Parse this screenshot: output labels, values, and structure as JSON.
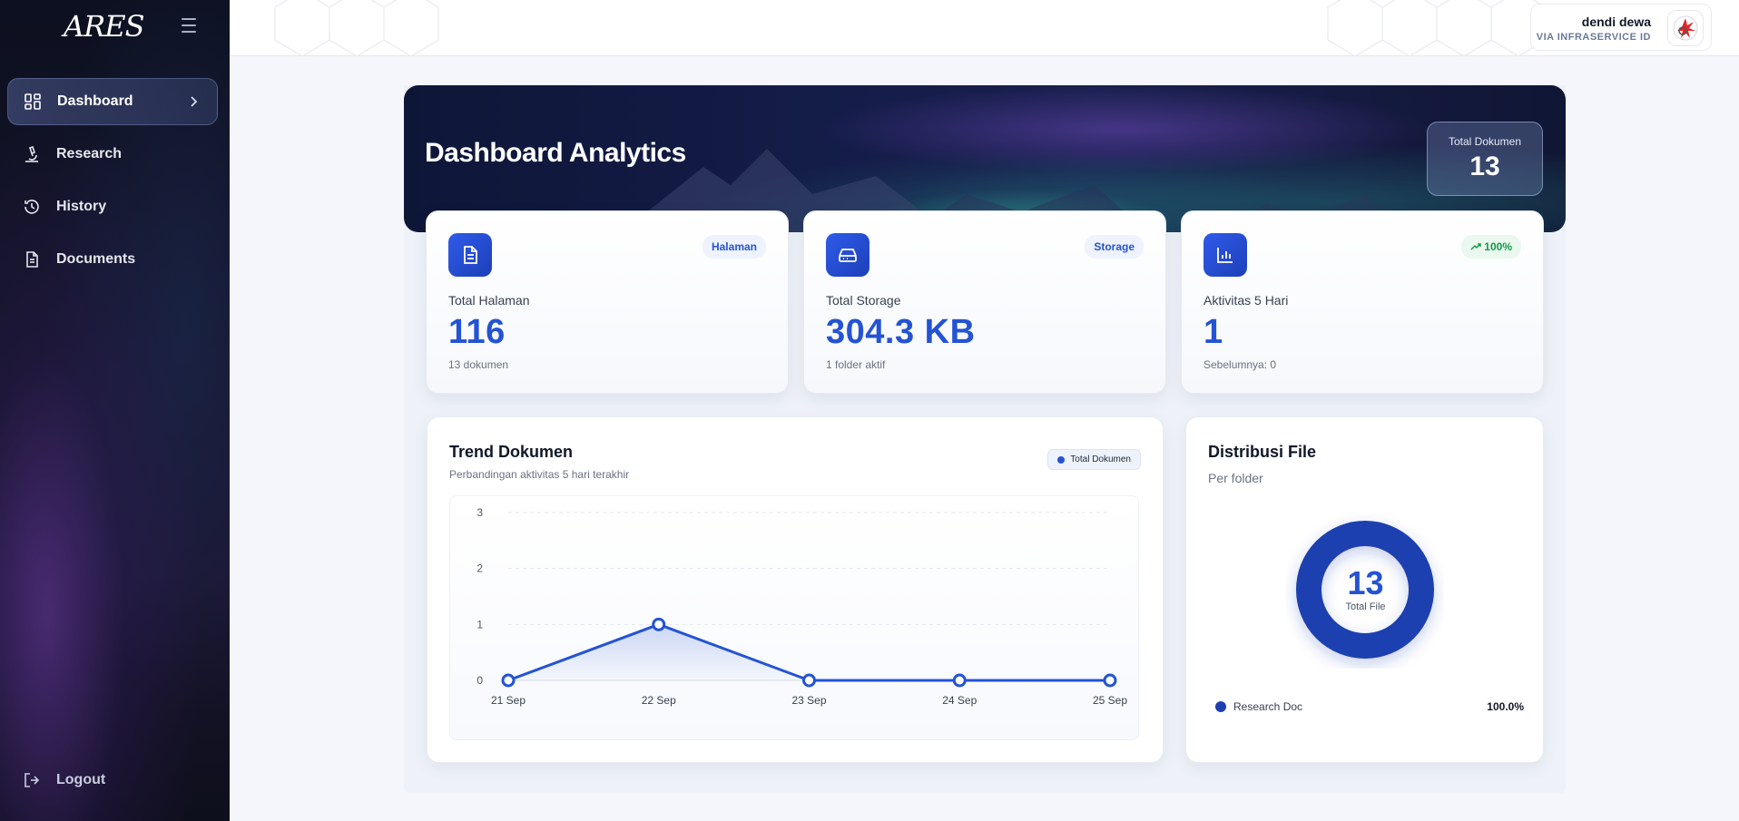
{
  "app": {
    "brand": "ARES"
  },
  "sidebar": {
    "items": [
      {
        "label": "Dashboard",
        "icon": "dashboard-icon",
        "active": true
      },
      {
        "label": "Research",
        "icon": "microscope-icon",
        "active": false
      },
      {
        "label": "History",
        "icon": "history-icon",
        "active": false
      },
      {
        "label": "Documents",
        "icon": "document-icon",
        "active": false
      }
    ],
    "logout_label": "Logout"
  },
  "user": {
    "name": "dendi dewa",
    "subtitle": "VIA INFRASERVICE ID"
  },
  "hero": {
    "title": "Dashboard Analytics",
    "badge_label": "Total Dokumen",
    "badge_value": "13"
  },
  "stats": [
    {
      "tag": "Halaman",
      "label": "Total Halaman",
      "value": "116",
      "sub": "13 dokumen",
      "icon": "file-icon"
    },
    {
      "tag": "Storage",
      "label": "Total Storage",
      "value": "304.3 KB",
      "sub": "1 folder aktif",
      "icon": "drive-icon"
    },
    {
      "tag": "100%",
      "label": "Aktivitas 5 Hari",
      "value": "1",
      "sub": "Sebelumnya: 0",
      "icon": "bar-chart-icon"
    }
  ],
  "trend": {
    "title": "Trend Dokumen",
    "subtitle": "Perbandingan aktivitas 5 hari terakhir",
    "legend": "Total Dokumen"
  },
  "distribution": {
    "title": "Distribusi File",
    "subtitle": "Per folder",
    "center_value": "13",
    "center_label": "Total File",
    "items": [
      {
        "label": "Research Doc",
        "percent": "100.0%"
      }
    ]
  },
  "colors": {
    "accent": "#2453d3",
    "donut": "#1f3fb0",
    "positive": "#169a4b"
  },
  "chart_data": {
    "type": "area",
    "categories": [
      "21 Sep",
      "22 Sep",
      "23 Sep",
      "24 Sep",
      "25 Sep"
    ],
    "series": [
      {
        "name": "Total Dokumen",
        "values": [
          0,
          1,
          0,
          0,
          0
        ]
      }
    ],
    "ylim": [
      0,
      3
    ],
    "yticks": [
      0,
      1,
      2,
      3
    ],
    "grid": true,
    "title": "Trend Dokumen",
    "subtitle": "Perbandingan aktivitas 5 hari terakhir"
  }
}
